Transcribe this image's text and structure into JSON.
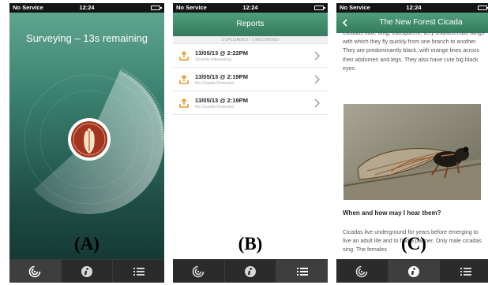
{
  "panels": [
    {
      "id": "A",
      "label": "(A)"
    },
    {
      "id": "B",
      "label": "(B)"
    },
    {
      "id": "C",
      "label": "(C)"
    }
  ],
  "status_bar": {
    "carrier": "No Service",
    "time": "12:24"
  },
  "colors": {
    "accent_green": "#3e8c6c",
    "tabbar": "#2b2b2b",
    "cicada_red": "#a2351f"
  },
  "survey": {
    "title": "Surveying – 13s remaining"
  },
  "reports": {
    "title": "Reports",
    "summary": "3 UPLOADED / 3 RECORDED",
    "items": [
      {
        "date": "13/05/13 @ 2:22PM",
        "note": "Sounds Interesting"
      },
      {
        "date": "13/05/13 @ 2:19PM",
        "note": "No Cicada Detected"
      },
      {
        "date": "13/05/13 @ 2:19PM",
        "note": "No Cicada Detected"
      }
    ]
  },
  "article": {
    "title": "The New Forest Cicada",
    "intro": "Cicadas have long, transparent, very characteristic wings with which they fly quickly from one branch to another. They are predominantly black, with orange lines across their abdomen and legs. They also have cute big black eyes.",
    "subheading": "When and how may I hear them?",
    "body": "Cicadas live underground for years before emerging to live an adult life and to find a partner. Only male cicadas sing. The females"
  },
  "tabs": [
    {
      "icon": "survey-spiral-icon"
    },
    {
      "icon": "info-icon"
    },
    {
      "icon": "list-icon"
    }
  ],
  "active_tab_by_panel": {
    "A": 0,
    "B": 2,
    "C": 1
  }
}
